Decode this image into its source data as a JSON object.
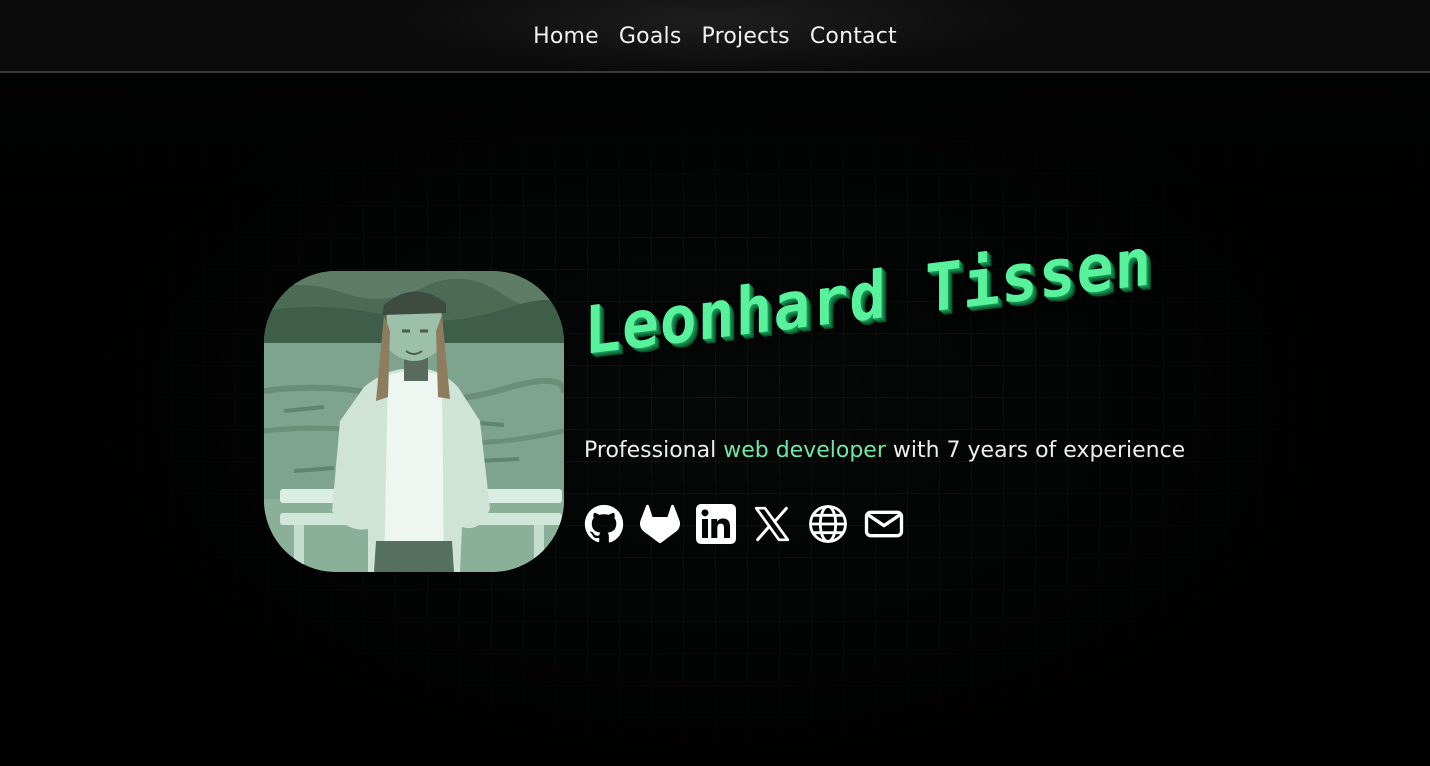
{
  "nav": {
    "items": [
      {
        "label": "Home"
      },
      {
        "label": "Goals"
      },
      {
        "label": "Projects"
      },
      {
        "label": "Contact"
      }
    ]
  },
  "hero": {
    "name": "Leonhard Tissen",
    "tagline": {
      "prefix": "Professional ",
      "highlight": "web developer",
      "suffix": " with 7 years of experience"
    },
    "photo_icon": "profile-photo",
    "socials": [
      {
        "icon": "github-icon"
      },
      {
        "icon": "gitlab-icon"
      },
      {
        "icon": "linkedin-icon"
      },
      {
        "icon": "x-icon"
      },
      {
        "icon": "globe-icon"
      },
      {
        "icon": "mail-icon"
      }
    ]
  },
  "colors": {
    "background": "#000000",
    "accent": "#6ee7a6",
    "name_green": "#59f29c",
    "text": "#eeeeee"
  }
}
